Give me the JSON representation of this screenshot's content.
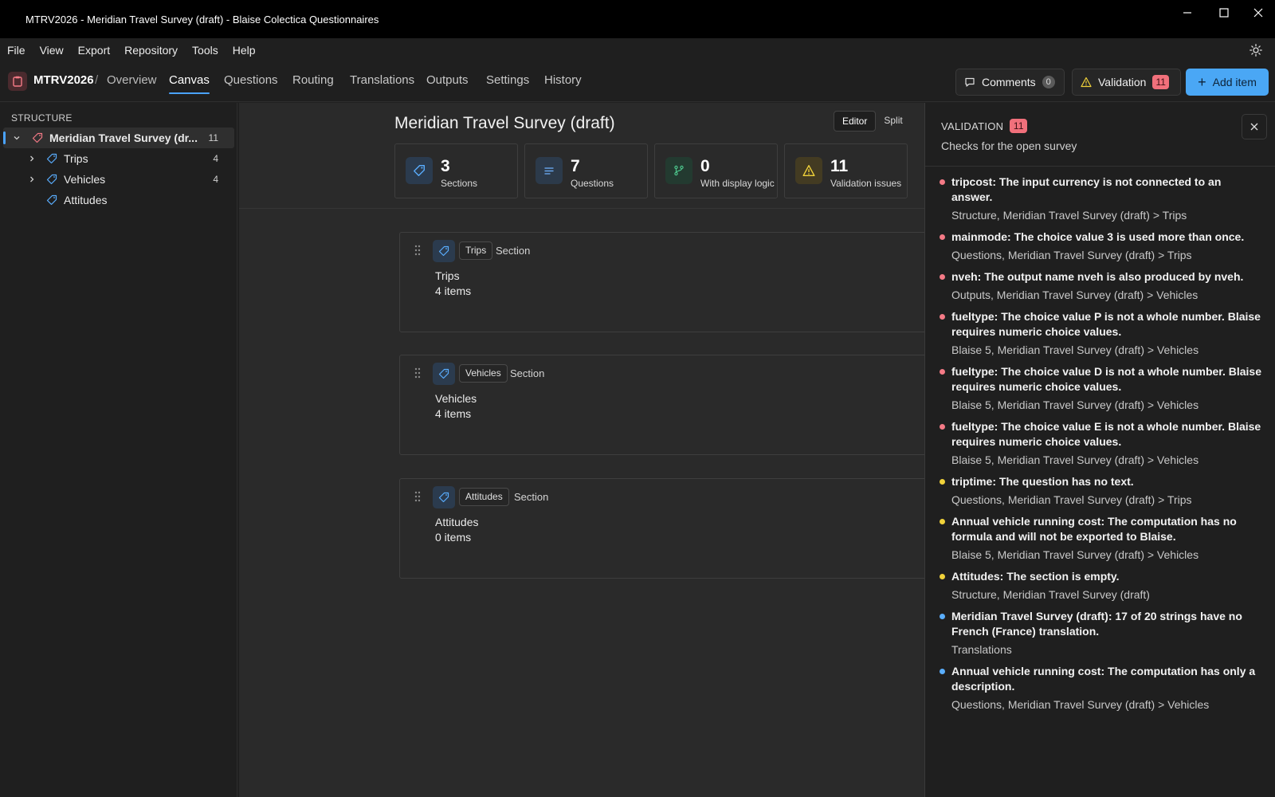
{
  "window": {
    "title": "MTRV2026 - Meridian Travel Survey (draft) - Blaise Colectica Questionnaires"
  },
  "menu": [
    "File",
    "View",
    "Export",
    "Repository",
    "Tools",
    "Help"
  ],
  "toolbar": {
    "code": "MTRV2026",
    "separator": "/",
    "overview": "Overview",
    "tabs": [
      "Canvas",
      "Questions",
      "Routing",
      "Translations",
      "Outputs",
      "Settings",
      "History"
    ],
    "active_tab": "Canvas",
    "comments_label": "Comments",
    "comments_count": "0",
    "validation_label": "Validation",
    "validation_count": "11",
    "add_label": "Add item",
    "accent_color": "#4aa7f5"
  },
  "sidebar": {
    "heading": "STRUCTURE",
    "root": {
      "label": "Meridian Travel Survey (dr...",
      "count": "11"
    },
    "items": [
      {
        "label": "Trips",
        "count": "4"
      },
      {
        "label": "Vehicles",
        "count": "4"
      },
      {
        "label": "Attitudes",
        "count": ""
      }
    ]
  },
  "canvas": {
    "title": "Meridian Travel Survey (draft)",
    "modes": [
      "Editor",
      "Split"
    ],
    "stats": [
      {
        "value": "3",
        "label": "Sections",
        "icon": "tag-icon"
      },
      {
        "value": "7",
        "label": "Questions",
        "icon": "lines-icon"
      },
      {
        "value": "0",
        "label": "With display logic",
        "icon": "branch-icon"
      },
      {
        "value": "11",
        "label": "Validation issues",
        "icon": "warning-icon"
      }
    ],
    "sections": [
      {
        "chip": "Trips",
        "type": "Section",
        "name": "Trips",
        "items": "4  items"
      },
      {
        "chip": "Vehicles",
        "type": "Section",
        "name": "Vehicles",
        "items": "4  items"
      },
      {
        "chip": "Attitudes",
        "type": "Section",
        "name": "Attitudes",
        "items": "0  items"
      }
    ]
  },
  "validation": {
    "title": "VALIDATION",
    "count": "11",
    "subtitle": "Checks for the open survey",
    "colors": {
      "error": "#f47a86",
      "warning": "#f0d23a",
      "info": "#5aaeff"
    },
    "items": [
      {
        "severity": "error",
        "message": "tripcost: The input currency is not connected to an answer.",
        "location": "Structure, Meridian Travel Survey (draft) > Trips"
      },
      {
        "severity": "error",
        "message": "mainmode: The choice value 3 is used more than once.",
        "location": "Questions, Meridian Travel Survey (draft) > Trips"
      },
      {
        "severity": "error",
        "message": "nveh: The output name nveh is also produced by nveh.",
        "location": "Outputs, Meridian Travel Survey (draft) > Vehicles"
      },
      {
        "severity": "error",
        "message": "fueltype: The choice value P is not a whole number. Blaise requires numeric choice values.",
        "location": "Blaise 5, Meridian Travel Survey (draft) > Vehicles"
      },
      {
        "severity": "error",
        "message": "fueltype: The choice value D is not a whole number. Blaise requires numeric choice values.",
        "location": "Blaise 5, Meridian Travel Survey (draft) > Vehicles"
      },
      {
        "severity": "error",
        "message": "fueltype: The choice value E is not a whole number. Blaise requires numeric choice values.",
        "location": "Blaise 5, Meridian Travel Survey (draft) > Vehicles"
      },
      {
        "severity": "warning",
        "message": "triptime: The question has no text.",
        "location": "Questions, Meridian Travel Survey (draft) > Trips"
      },
      {
        "severity": "warning",
        "message": "Annual vehicle running cost: The computation has no formula and will not be exported to Blaise.",
        "location": "Blaise 5, Meridian Travel Survey (draft) > Vehicles"
      },
      {
        "severity": "warning",
        "message": "Attitudes: The section is empty.",
        "location": "Structure, Meridian Travel Survey (draft)"
      },
      {
        "severity": "info",
        "message": "Meridian Travel Survey (draft): 17 of 20 strings have no French (France) translation.",
        "location": "Translations"
      },
      {
        "severity": "info",
        "message": "Annual vehicle running cost: The computation has only a description.",
        "location": "Questions, Meridian Travel Survey (draft) > Vehicles"
      }
    ]
  }
}
